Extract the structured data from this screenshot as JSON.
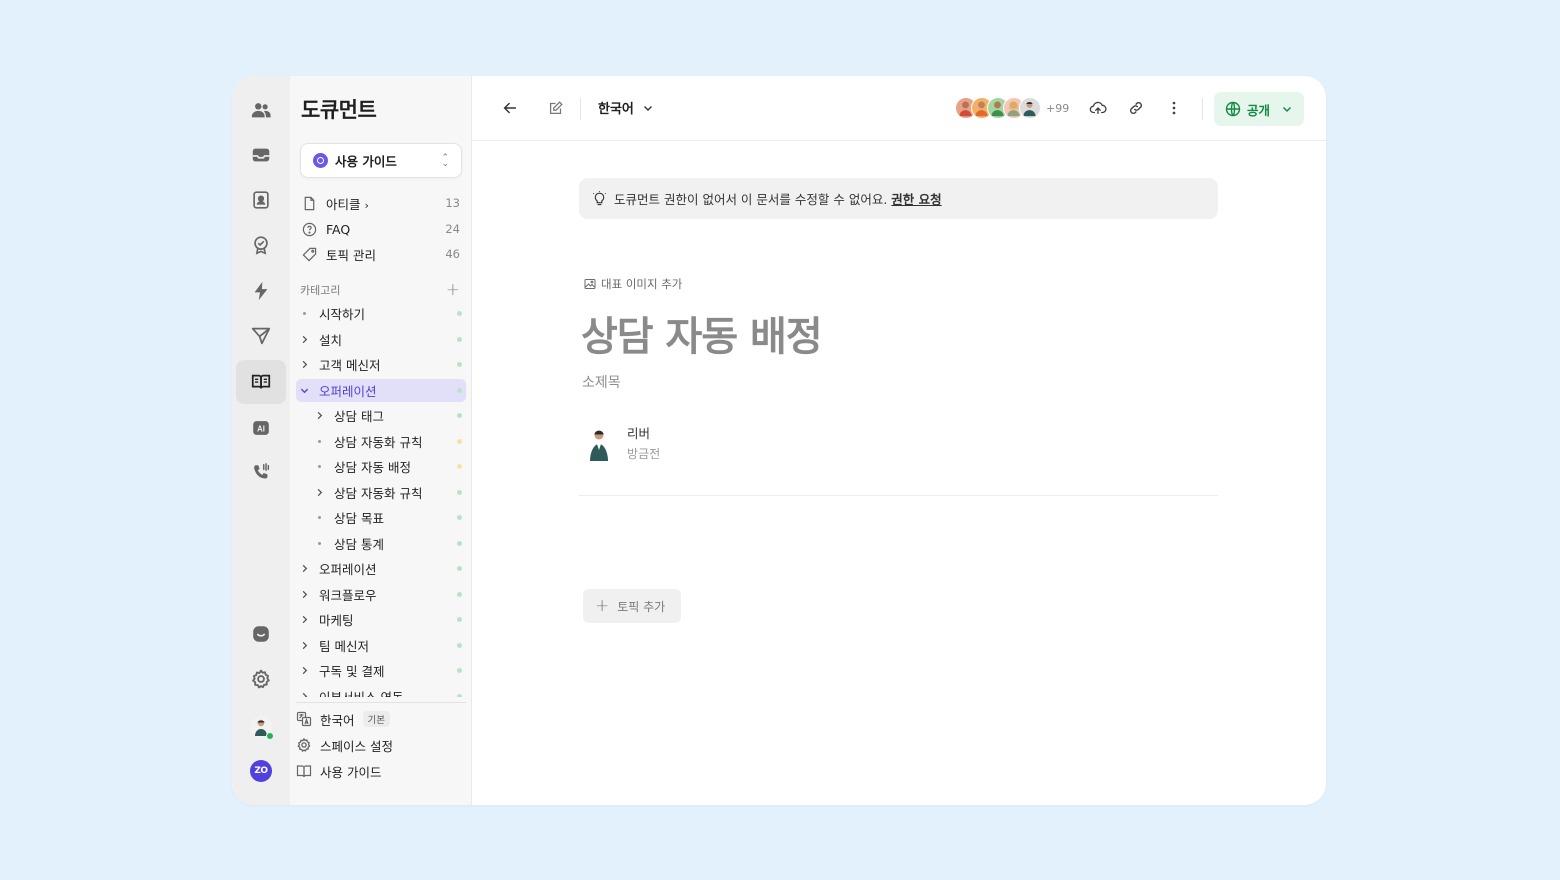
{
  "sidebar": {
    "title": "도큐먼트",
    "space_select": "사용 가이드",
    "nav": [
      {
        "label": "아티클",
        "count": "13",
        "icon": "file-icon"
      },
      {
        "label": "FAQ",
        "count": "24",
        "icon": "question-icon"
      },
      {
        "label": "토픽 관리",
        "count": "46",
        "icon": "tag-icon"
      }
    ],
    "categories_header": "카테고리",
    "categories": [
      {
        "label": "시작하기",
        "expander": "bullet",
        "status": "#b9e3c6"
      },
      {
        "label": "설치",
        "expander": "chevron-right",
        "status": "#b9e3c6"
      },
      {
        "label": "고객 메신저",
        "expander": "chevron-right",
        "status": "#b9e3c6"
      },
      {
        "label": "오퍼레이션",
        "expander": "chevron-down",
        "status": "#b9e3c6",
        "selected": true
      },
      {
        "label": "상담 태그",
        "expander": "chevron-right",
        "status": "#b9e3c6",
        "indent": 1
      },
      {
        "label": "상담 자동화 규칙",
        "expander": "bullet",
        "status": "#f2e3a8",
        "indent": 1
      },
      {
        "label": "상담 자동 배정",
        "expander": "bullet",
        "status": "#f2e3a8",
        "indent": 1
      },
      {
        "label": "상담 자동화 규칙",
        "expander": "chevron-right",
        "status": "#b9e3c6",
        "indent": 1
      },
      {
        "label": "상담 목표",
        "expander": "bullet",
        "status": "#b9e3c6",
        "indent": 1
      },
      {
        "label": "상담 통계",
        "expander": "bullet",
        "status": "#b9e3c6",
        "indent": 1
      },
      {
        "label": "오퍼레이션",
        "expander": "chevron-right",
        "status": "#b9e3c6"
      },
      {
        "label": "워크플로우",
        "expander": "chevron-right",
        "status": "#b9e3c6"
      },
      {
        "label": "마케팅",
        "expander": "chevron-right",
        "status": "#b9e3c6"
      },
      {
        "label": "팀 메신저",
        "expander": "chevron-right",
        "status": "#b9e3c6"
      },
      {
        "label": "구독 및 결제",
        "expander": "chevron-right",
        "status": "#b9e3c6"
      },
      {
        "label": "이부서비스 연동",
        "expander": "chevron-right",
        "status": "#b9e3c6"
      }
    ],
    "bottom": {
      "language": "한국어",
      "language_badge": "기본",
      "space_settings": "스페이스 설정",
      "user_guide": "사용 가이드"
    }
  },
  "topbar": {
    "language": "한국어",
    "avatar_more": "+99",
    "public_label": "공개"
  },
  "document": {
    "notice": "도큐먼트 권한이 없어서 이 문서를 수정할 수 없어요.",
    "notice_link": "권한 요청",
    "cover_add": "대표 이미지 추가",
    "title": "상담 자동 배정",
    "subtitle": "소제목",
    "author": "리버",
    "updated": "방금전",
    "add_topic": "토픽 추가"
  },
  "colors": {
    "accent": "#5040d8",
    "public_green": "#138a43",
    "background": "#e3f1fd"
  }
}
